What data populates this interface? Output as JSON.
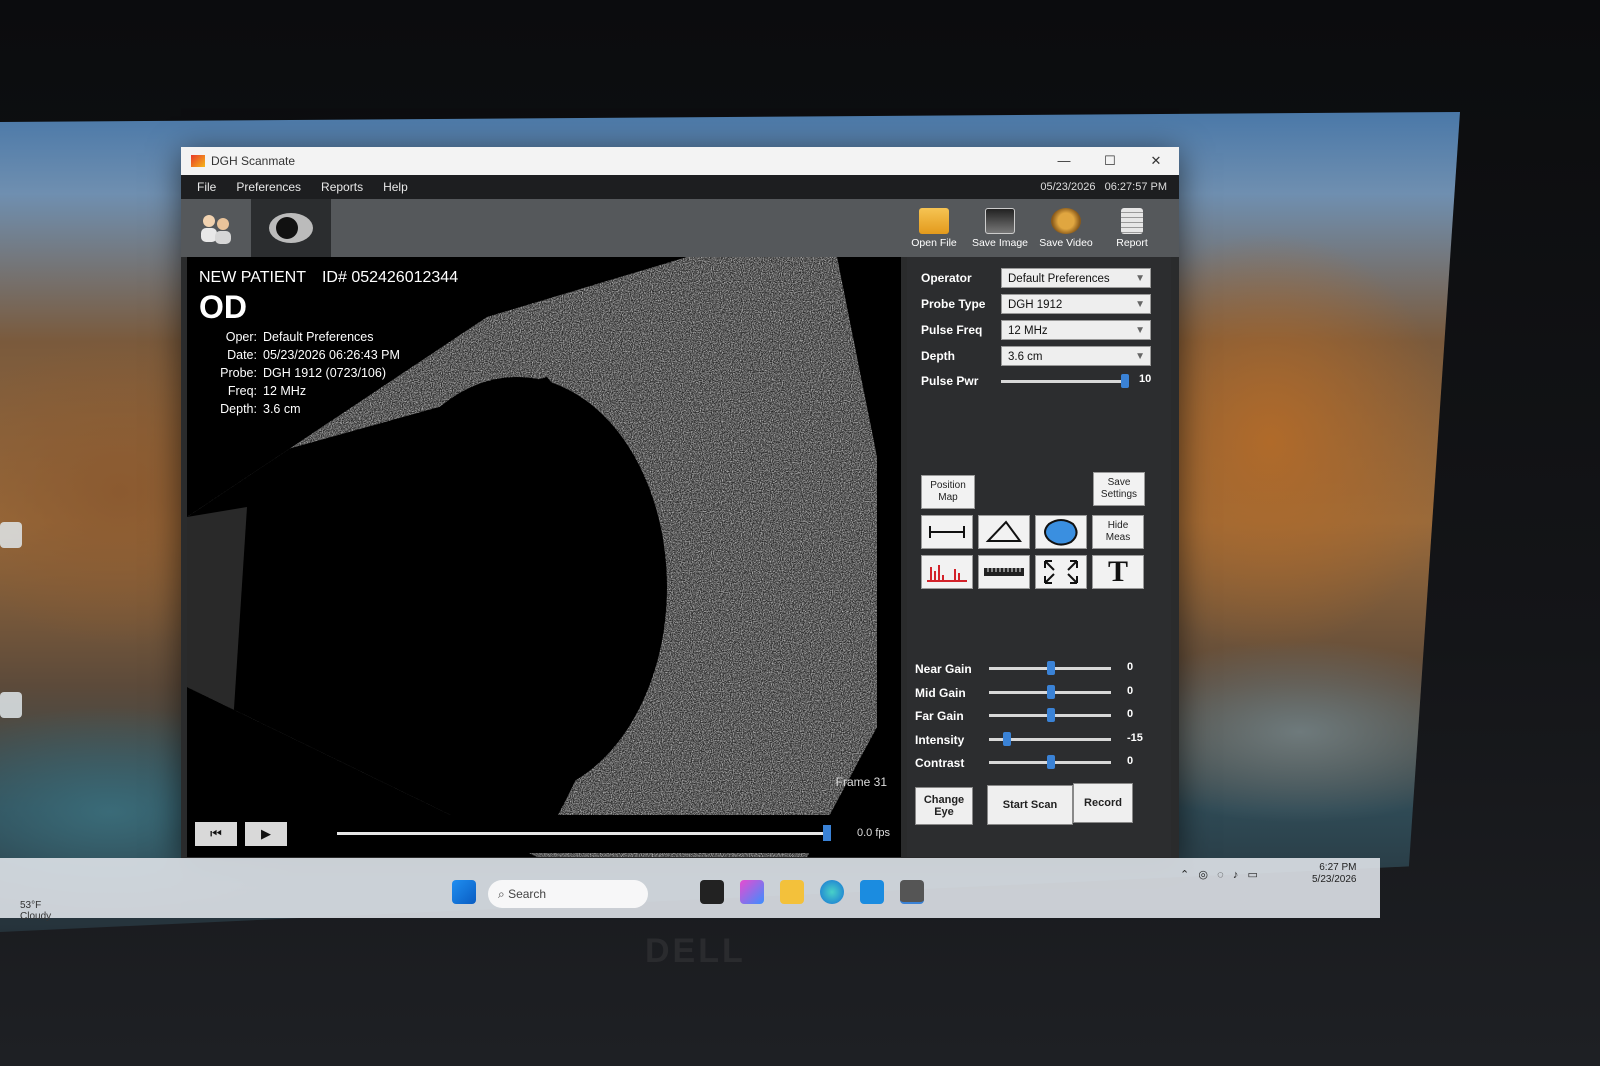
{
  "window": {
    "title": "DGH Scanmate",
    "controls": [
      "—",
      "☐",
      "✕"
    ]
  },
  "menu": {
    "items": [
      "File",
      "Preferences",
      "Reports",
      "Help"
    ],
    "date": "05/23/2026",
    "time": "06:27:57 PM"
  },
  "toolbar": {
    "buttons": [
      "Open File",
      "Save Image",
      "Save Video",
      "Report"
    ]
  },
  "scan": {
    "patient": "NEW PATIENT",
    "patient_id": "ID# 052426012344",
    "eye": "OD",
    "info": [
      {
        "label": "Oper:",
        "value": "Default Preferences"
      },
      {
        "label": "Date:",
        "value": "05/23/2026   06:26:43  PM"
      },
      {
        "label": "Probe:",
        "value": "DGH 1912 (0723/106)"
      },
      {
        "label": "Freq:",
        "value": "12 MHz"
      },
      {
        "label": "Depth:",
        "value": "3.6 cm"
      }
    ],
    "frame": "Frame 31",
    "fps": "0.0  fps",
    "progress": 1.0
  },
  "settings": {
    "operator": {
      "label": "Operator",
      "value": "Default Preferences"
    },
    "probe_type": {
      "label": "Probe Type",
      "value": "DGH 1912"
    },
    "pulse_freq": {
      "label": "Pulse Freq",
      "value": "12 MHz"
    },
    "depth": {
      "label": "Depth",
      "value": "3.6 cm"
    },
    "pulse_pwr": {
      "label": "Pulse Pwr",
      "value": "10",
      "level": 1.0
    }
  },
  "tools": {
    "position_map": "Position\nMap",
    "save_settings": "Save\nSettings",
    "hide_meas": "Hide\nMeas",
    "text_tool": "T"
  },
  "gains": [
    {
      "label": "Near Gain",
      "value": "0",
      "level": 0.5
    },
    {
      "label": "Mid Gain",
      "value": "0",
      "level": 0.5
    },
    {
      "label": "Far Gain",
      "value": "0",
      "level": 0.5
    },
    {
      "label": "Intensity",
      "value": "-15",
      "level": 0.12
    },
    {
      "label": "Contrast",
      "value": "0",
      "level": 0.5
    }
  ],
  "actions": {
    "change_eye": "Change\nEye",
    "start_scan": "Start Scan",
    "record": "Record"
  },
  "taskbar": {
    "weather_temp": "53°F",
    "weather_desc": "Cloudy",
    "search": "Search",
    "time": "6:27 PM",
    "date": "5/23/2026"
  },
  "bezel": {
    "brand": "DELL"
  },
  "colors": {
    "accent": "#3a82d6",
    "panel": "#2c2d2f",
    "toolbar": "#55585b"
  }
}
